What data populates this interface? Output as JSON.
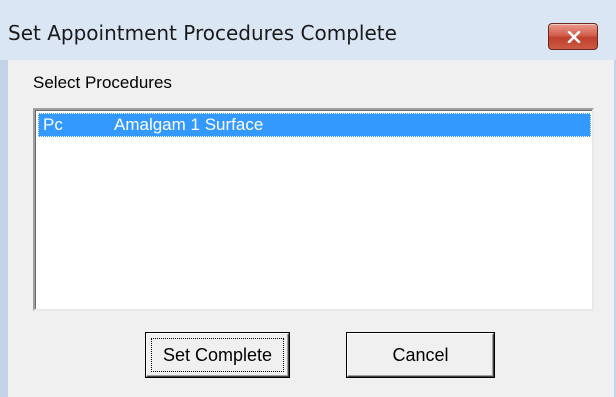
{
  "window": {
    "title": "Set Appointment Procedures Complete"
  },
  "title_bar": {
    "close_icon": "close-x-icon",
    "close_color": "#c74d3a"
  },
  "procedures": {
    "label": "Select Procedures",
    "items": [
      {
        "code": "Pc",
        "description": "Amalgam 1 Surface",
        "selected": true
      }
    ],
    "selection_color": "#3399ff"
  },
  "buttons": {
    "set_complete": "Set Complete",
    "cancel": "Cancel"
  }
}
